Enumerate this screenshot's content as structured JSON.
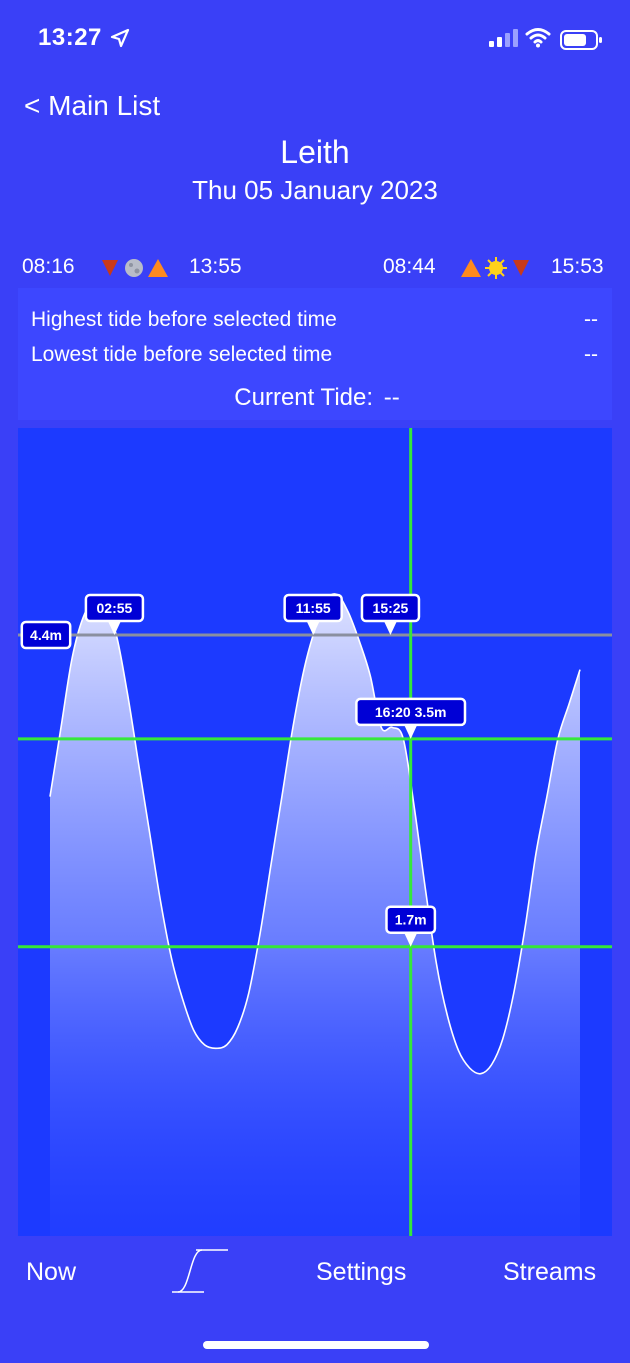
{
  "status": {
    "time": "13:27"
  },
  "nav": {
    "back_label": "< Main List"
  },
  "header": {
    "location": "Leith",
    "date": "Thu 05 January 2023"
  },
  "sun_moon": {
    "moonrise": "08:16",
    "moonset": "13:55",
    "sunrise": "08:44",
    "sunset": "15:53"
  },
  "info": {
    "highest_label": "Highest tide before selected time",
    "highest_value": "--",
    "lowest_label": "Lowest tide before selected time",
    "lowest_value": "--",
    "current_label": "Current Tide:",
    "current_value": "--"
  },
  "chart_data": {
    "type": "area",
    "x_unit": "hours",
    "xlim": [
      0,
      24
    ],
    "ylim": [
      0,
      5.5
    ],
    "x": [
      0.0,
      0.5,
      1.0,
      1.5,
      2.0,
      2.5,
      3.0,
      3.5,
      4.0,
      4.5,
      5.0,
      5.5,
      6.0,
      6.5,
      7.0,
      7.5,
      8.0,
      8.5,
      9.0,
      9.5,
      10.0,
      10.5,
      11.0,
      11.5,
      12.0,
      12.5,
      13.0,
      13.5,
      14.0,
      14.5,
      15.0,
      15.5,
      16.0,
      16.5,
      17.0,
      17.5,
      18.0,
      18.5,
      19.0,
      19.5,
      20.0,
      20.5,
      21.0,
      21.5,
      22.0,
      22.5,
      23.0,
      23.5,
      24.0
    ],
    "y": [
      3.0,
      3.6,
      4.2,
      4.55,
      4.7,
      4.6,
      4.4,
      3.9,
      3.3,
      2.7,
      2.1,
      1.6,
      1.25,
      0.98,
      0.85,
      0.82,
      0.85,
      1.0,
      1.3,
      1.8,
      2.4,
      3.0,
      3.6,
      4.1,
      4.45,
      4.7,
      4.75,
      4.6,
      4.35,
      4.05,
      3.6,
      3.6,
      3.5,
      2.9,
      2.2,
      1.55,
      1.1,
      0.8,
      0.65,
      0.6,
      0.68,
      0.9,
      1.3,
      1.85,
      2.5,
      3.0,
      3.5,
      3.8,
      4.1
    ],
    "reference_level_label": "4.4m",
    "reference_level": 4.4,
    "marker_labels": [
      "02:55",
      "11:55",
      "15:25"
    ],
    "marker_times": [
      2.9167,
      11.9167,
      15.4167
    ],
    "selected": {
      "label": "16:20  3.5m",
      "time": 16.333,
      "height": 3.5
    },
    "low_line": {
      "label": "1.7m",
      "height": 1.7
    },
    "colors": {
      "background": "#1c3aff",
      "curve": "#ffffff",
      "cursor": "#35e83a",
      "reference": "#8a8fa0",
      "label_fill": "#0000d6"
    }
  },
  "tabs": {
    "now": "Now",
    "graph_icon": "tide-graph-icon",
    "settings": "Settings",
    "streams": "Streams"
  }
}
